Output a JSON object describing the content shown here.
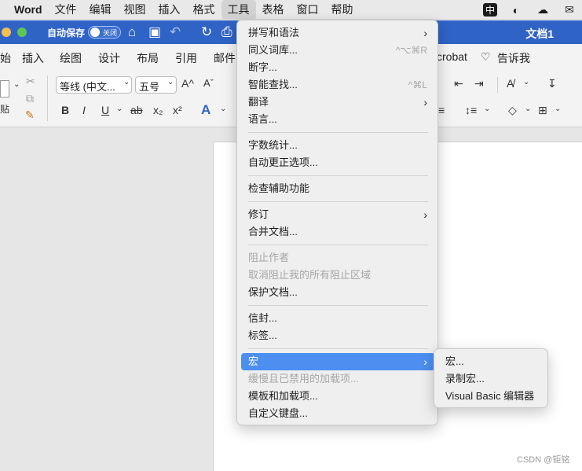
{
  "menubar": {
    "app": "Word",
    "items": [
      "文件",
      "编辑",
      "视图",
      "插入",
      "格式",
      "工具",
      "表格",
      "窗口",
      "帮助"
    ],
    "active_index": 5,
    "ime": "中"
  },
  "titlebar": {
    "autosave_label": "自动保存",
    "autosave_state": "关闭",
    "doc_title": "文档1",
    "colors": {
      "bar": "#2f63c6"
    }
  },
  "ribbon_tabs": [
    "始",
    "插入",
    "绘图",
    "设计",
    "布局",
    "引用",
    "邮件",
    "crobat",
    "告诉我"
  ],
  "ribbon": {
    "paste_label": "贴",
    "font_name": "等线 (中文...",
    "font_size": "五号",
    "bold": "B",
    "italic": "I",
    "underline": "U",
    "strike": "ab",
    "subscript": "x₂",
    "superscript": "x²",
    "grow": "A^",
    "shrink": "Aˇ"
  },
  "menu": {
    "items": [
      {
        "label": "拼写和语法",
        "arrow": true
      },
      {
        "label": "同义词库...",
        "shortcut": "^⌥⌘R"
      },
      {
        "label": "断字..."
      },
      {
        "label": "智能查找...",
        "shortcut": "^⌘L"
      },
      {
        "label": "翻译",
        "arrow": true
      },
      {
        "label": "语言..."
      },
      {
        "label": "字数统计..."
      },
      {
        "label": "自动更正选项..."
      },
      {
        "label": "检查辅助功能"
      },
      {
        "label": "修订",
        "arrow": true
      },
      {
        "label": "合并文档..."
      },
      {
        "label": "阻止作者",
        "disabled": true
      },
      {
        "label": "取消阻止我的所有阻止区域",
        "disabled": true
      },
      {
        "label": "保护文档..."
      },
      {
        "label": "信封..."
      },
      {
        "label": "标签..."
      },
      {
        "label": "宏",
        "arrow": true,
        "highlighted": true
      },
      {
        "label": "缓慢且已禁用的加载项...",
        "disabled": true
      },
      {
        "label": "模板和加载项..."
      },
      {
        "label": "自定义键盘..."
      }
    ],
    "highlight_color": "#4c8ff0"
  },
  "submenu": {
    "items": [
      "宏...",
      "录制宏...",
      "Visual Basic 编辑器"
    ]
  },
  "watermark": "CSDN @钜铭"
}
